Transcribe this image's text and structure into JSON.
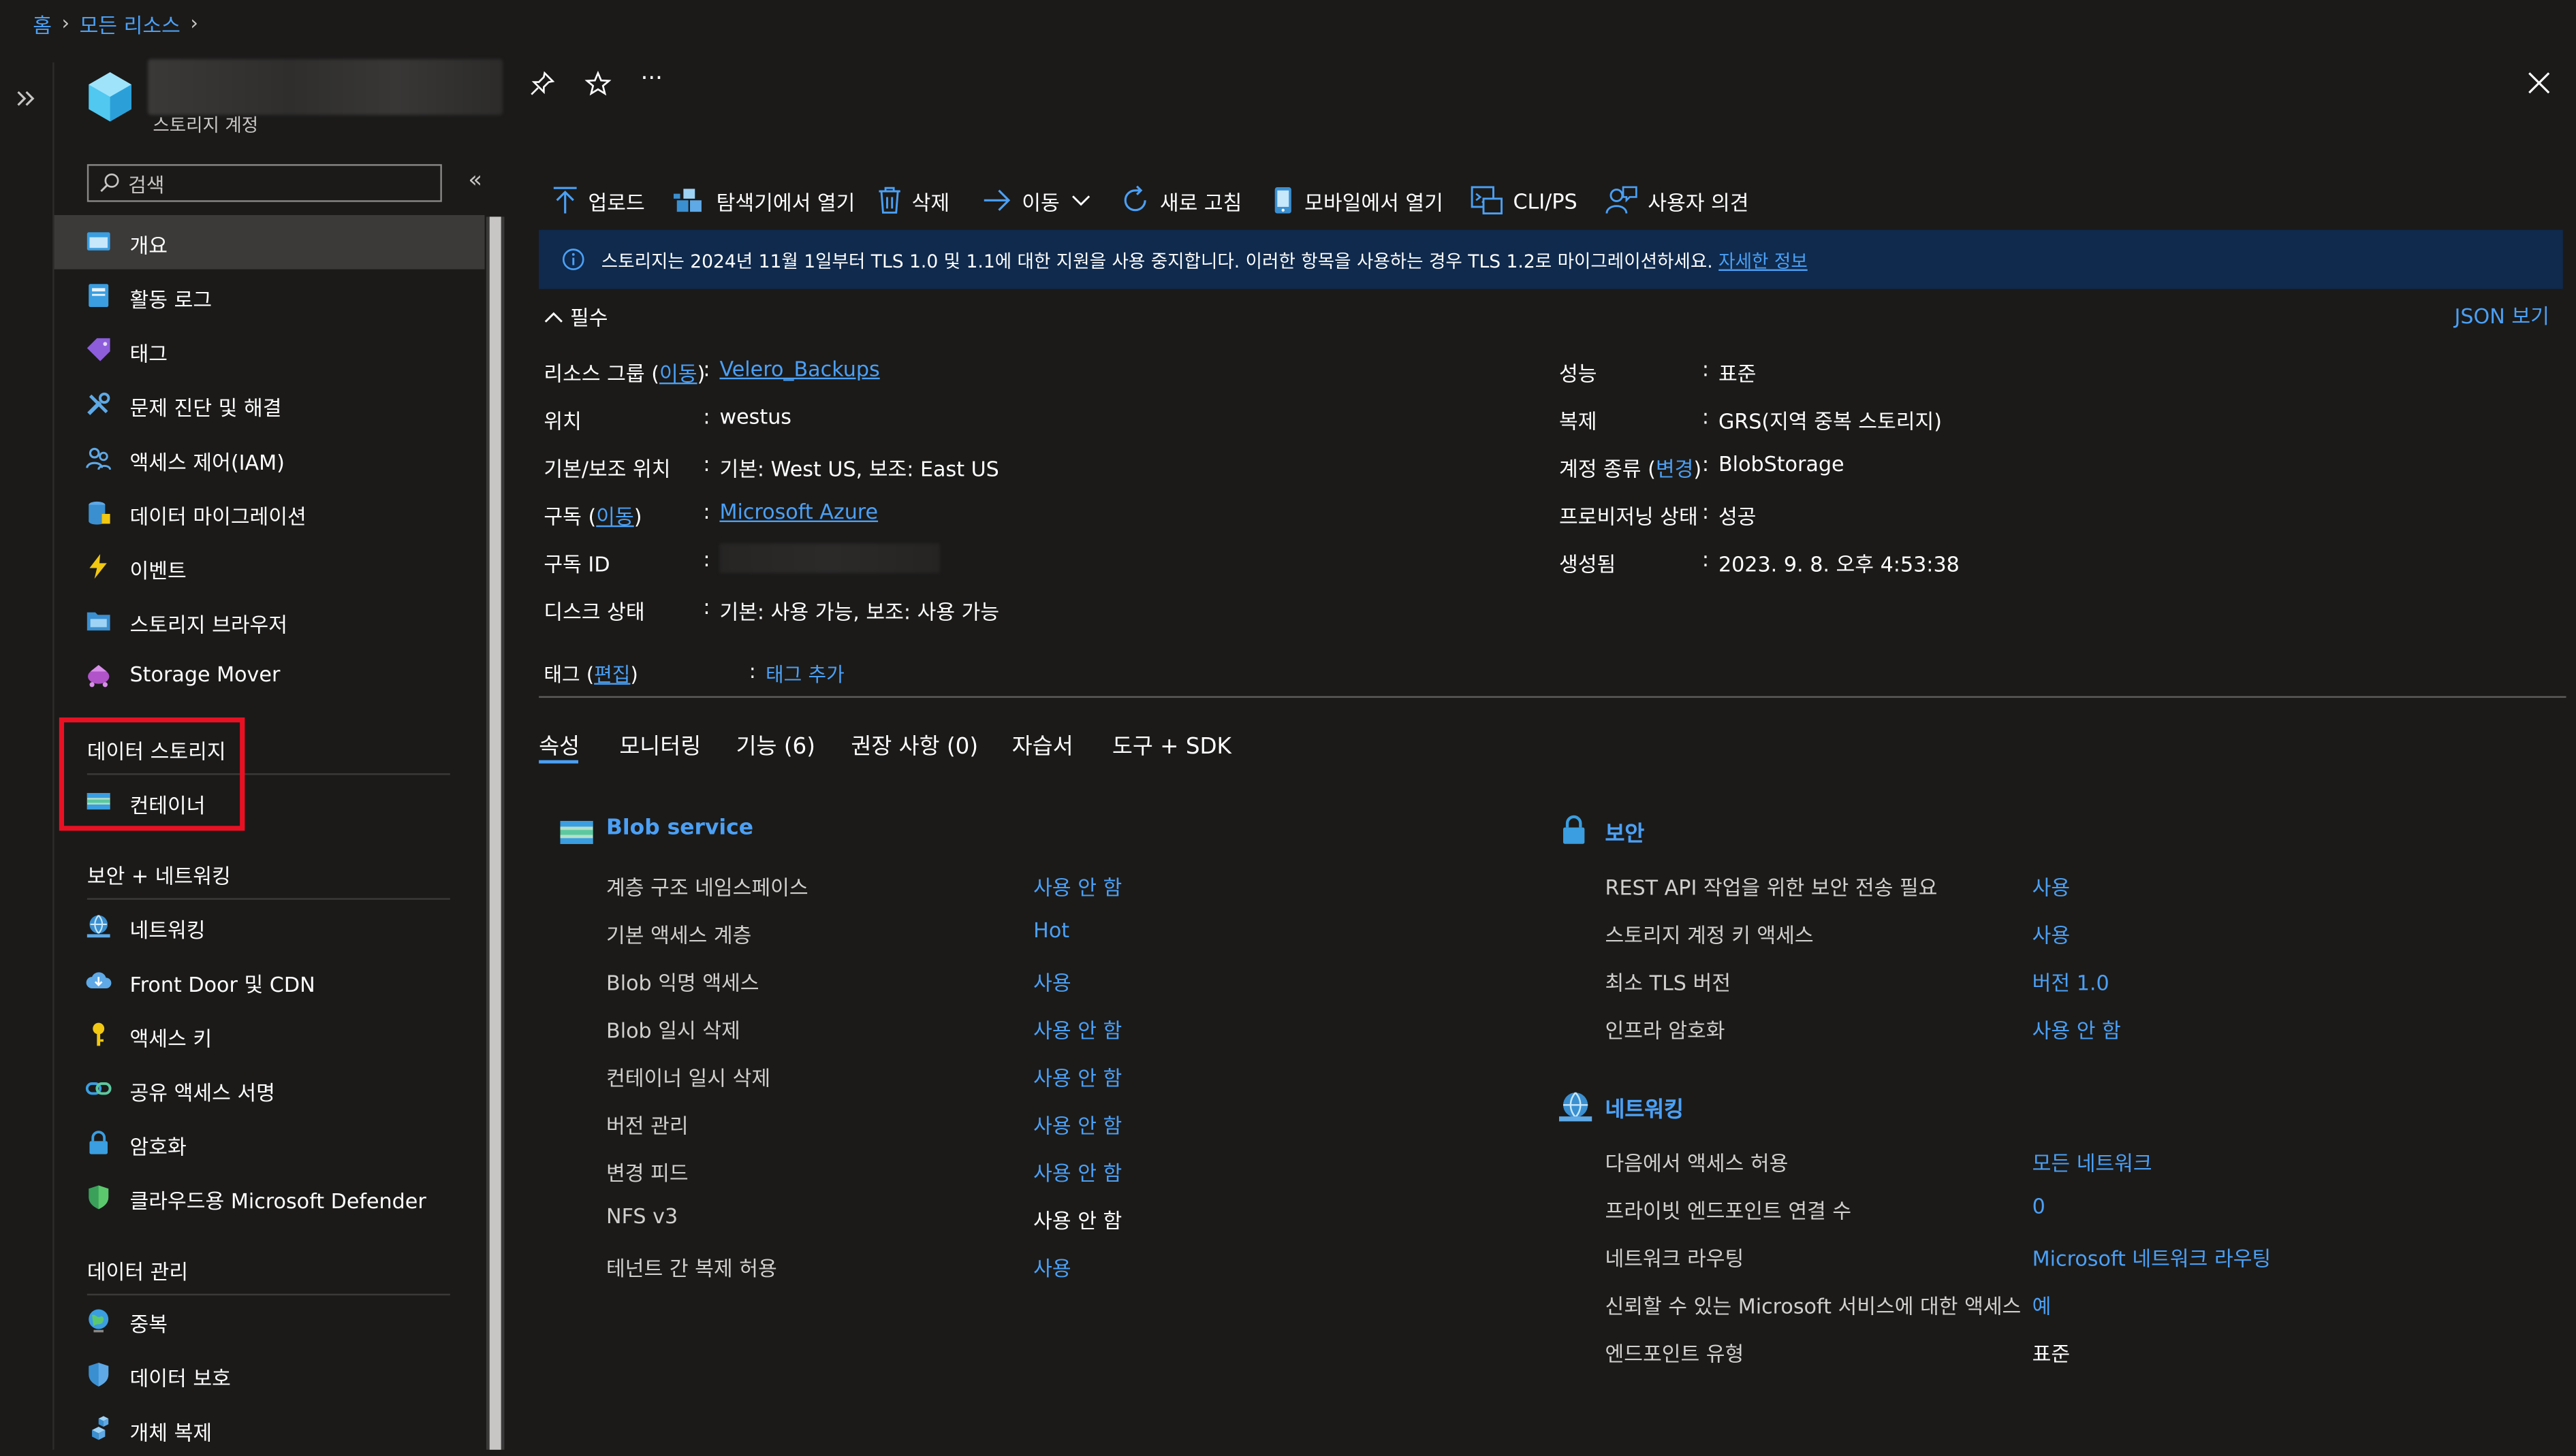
{
  "breadcrumb": {
    "home": "홈",
    "all_resources": "모든 리소스"
  },
  "resource": {
    "type_label": "스토리지 계정"
  },
  "sidebar": {
    "search_placeholder": "검색",
    "items": [
      "개요",
      "활동 로그",
      "태그",
      "문제 진단 및 해결",
      "액세스 제어(IAM)",
      "데이터 마이그레이션",
      "이벤트",
      "스토리지 브라우저",
      "Storage Mover"
    ],
    "data_storage": {
      "header": "데이터 스토리지",
      "items": [
        "컨테이너"
      ]
    },
    "security_networking": {
      "header": "보안 + 네트워킹",
      "items": [
        "네트워킹",
        "Front Door 및 CDN",
        "액세스 키",
        "공유 액세스 서명",
        "암호화",
        "클라우드용 Microsoft Defender"
      ]
    },
    "data_management": {
      "header": "데이터 관리",
      "items": [
        "중복",
        "데이터 보호",
        "개체 복제"
      ]
    }
  },
  "toolbar": {
    "upload": "업로드",
    "open_explorer": "탐색기에서 열기",
    "delete": "삭제",
    "move": "이동",
    "refresh": "새로 고침",
    "open_mobile": "모바일에서 열기",
    "cli_ps": "CLI/PS",
    "feedback": "사용자 의견"
  },
  "banner": {
    "message": "스토리지는 2024년 11월 1일부터 TLS 1.0 및 1.1에 대한 지원을 사용 중지합니다. 이러한 항목을 사용하는 경우 TLS 1.2로 마이그레이션하세요.",
    "link": "자세한 정보"
  },
  "essentials": {
    "toggle_label": "필수",
    "json_view": "JSON 보기",
    "move_link": "이동",
    "change_link": "변경",
    "edit_link": "편집",
    "left": [
      {
        "label": "리소스 그룹",
        "value": "Velero_Backups",
        "is_link": true
      },
      {
        "label": "위치",
        "value": "westus"
      },
      {
        "label": "기본/보조 위치",
        "value": "기본: West US, 보조: East US"
      },
      {
        "label": "구독",
        "value": "Microsoft Azure",
        "is_link": true
      },
      {
        "label": "구독 ID",
        "value": ""
      },
      {
        "label": "디스크 상태",
        "value": "기본: 사용 가능, 보조: 사용 가능"
      }
    ],
    "right": [
      {
        "label": "성능",
        "value": "표준"
      },
      {
        "label": "복제",
        "value": "GRS(지역 중복 스토리지)"
      },
      {
        "label": "계정 종류",
        "value": "BlobStorage"
      },
      {
        "label": "프로비저닝 상태",
        "value": "성공"
      },
      {
        "label": "생성됨",
        "value": "2023. 9. 8. 오후 4:53:38"
      }
    ],
    "tags": {
      "label": "태그",
      "add": "태그 추가"
    }
  },
  "tabs": [
    "속성",
    "모니터링",
    "기능 (6)",
    "권장 사항 (0)",
    "자습서",
    "도구 + SDK"
  ],
  "properties": {
    "blob": {
      "title": "Blob service",
      "rows": [
        {
          "label": "계층 구조 네임스페이스",
          "value": "사용 안 함",
          "link": true
        },
        {
          "label": "기본 액세스 계층",
          "value": "Hot",
          "link": true
        },
        {
          "label": "Blob 익명 액세스",
          "value": "사용",
          "link": true
        },
        {
          "label": "Blob 일시 삭제",
          "value": "사용 안 함",
          "link": true
        },
        {
          "label": "컨테이너 일시 삭제",
          "value": "사용 안 함",
          "link": true
        },
        {
          "label": "버전 관리",
          "value": "사용 안 함",
          "link": true
        },
        {
          "label": "변경 피드",
          "value": "사용 안 함",
          "link": true
        },
        {
          "label": "NFS v3",
          "value": "사용 안 함",
          "link": false
        },
        {
          "label": "테넌트 간 복제 허용",
          "value": "사용",
          "link": true
        }
      ]
    },
    "security": {
      "title": "보안",
      "rows": [
        {
          "label": "REST API 작업을 위한 보안 전송 필요",
          "value": "사용",
          "link": true
        },
        {
          "label": "스토리지 계정 키 액세스",
          "value": "사용",
          "link": true
        },
        {
          "label": "최소 TLS 버전",
          "value": "버전 1.0",
          "link": true
        },
        {
          "label": "인프라 암호화",
          "value": "사용 안 함",
          "link": true
        }
      ]
    },
    "networking": {
      "title": "네트워킹",
      "rows": [
        {
          "label": "다음에서 액세스 허용",
          "value": "모든 네트워크",
          "link": true
        },
        {
          "label": "프라이빗 엔드포인트 연결 수",
          "value": "0",
          "link": true
        },
        {
          "label": "네트워크 라우팅",
          "value": "Microsoft 네트워크 라우팅",
          "link": true
        },
        {
          "label": "신뢰할 수 있는 Microsoft 서비스에 대한 액세스",
          "value": "예",
          "link": true
        },
        {
          "label": "엔드포인트 유형",
          "value": "표준",
          "link": false
        }
      ]
    }
  },
  "colors": {
    "accent": "#4ba0f5",
    "highlight_box": "#e81123",
    "banner_bg": "#0f2a4d"
  }
}
